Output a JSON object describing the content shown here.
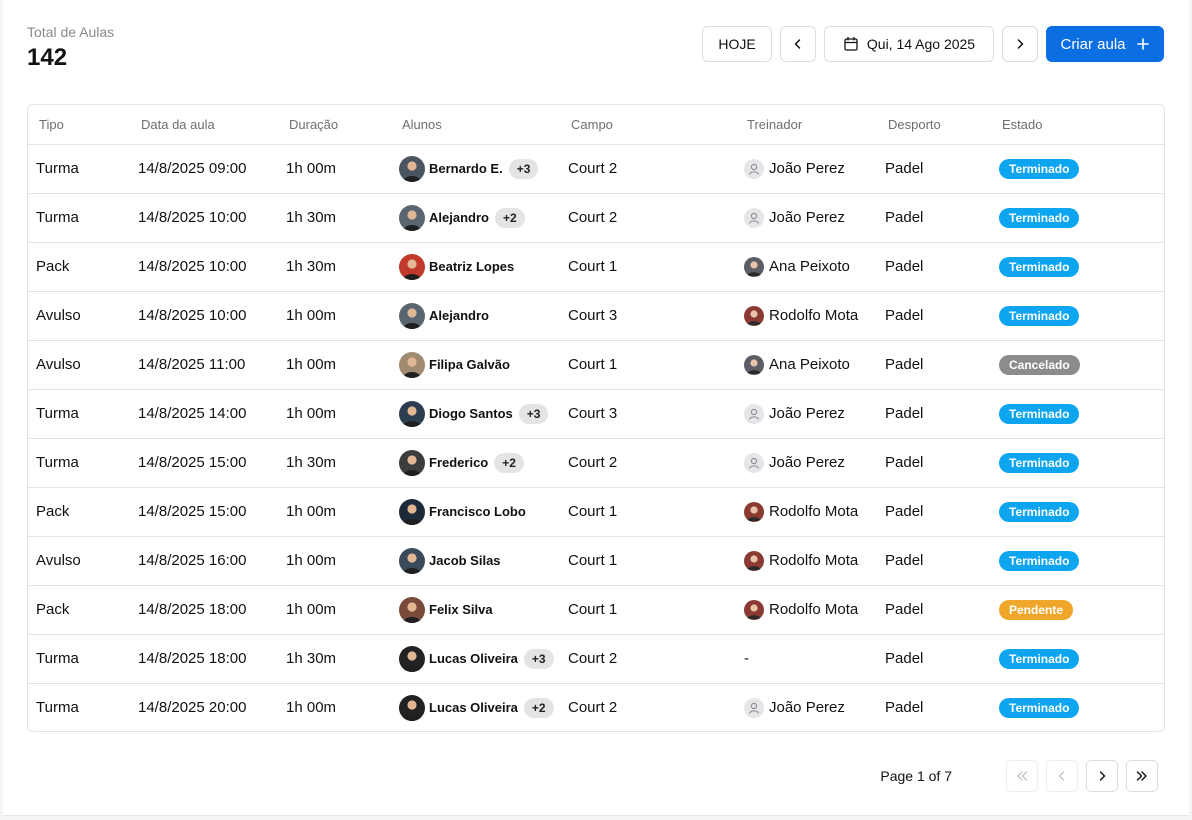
{
  "header": {
    "total_label": "Total de Aulas",
    "total_value": "142"
  },
  "toolbar": {
    "today_label": "HOJE",
    "date_label": "Qui, 14 Ago 2025",
    "create_label": "Criar aula",
    "accent_color": "#0b6ee3"
  },
  "table": {
    "columns": [
      "Tipo",
      "Data da aula",
      "Duração",
      "Alunos",
      "Campo",
      "Treinador",
      "Desporto",
      "Estado"
    ],
    "rows": [
      {
        "tipo": "Turma",
        "data": "14/8/2025 09:00",
        "duracao": "1h 00m",
        "aluno": "Bernardo E.",
        "extra": "+3",
        "campo": "Court 2",
        "treinador": "João Perez",
        "desporto": "Padel",
        "estado": "Terminado"
      },
      {
        "tipo": "Turma",
        "data": "14/8/2025 10:00",
        "duracao": "1h 30m",
        "aluno": "Alejandro",
        "extra": "+2",
        "campo": "Court 2",
        "treinador": "João Perez",
        "desporto": "Padel",
        "estado": "Terminado"
      },
      {
        "tipo": "Pack",
        "data": "14/8/2025 10:00",
        "duracao": "1h 30m",
        "aluno": "Beatriz Lopes",
        "extra": "",
        "campo": "Court 1",
        "treinador": "Ana Peixoto",
        "desporto": "Padel",
        "estado": "Terminado"
      },
      {
        "tipo": "Avulso",
        "data": "14/8/2025 10:00",
        "duracao": "1h 00m",
        "aluno": "Alejandro",
        "extra": "",
        "campo": "Court 3",
        "treinador": "Rodolfo Mota",
        "desporto": "Padel",
        "estado": "Terminado"
      },
      {
        "tipo": "Avulso",
        "data": "14/8/2025 11:00",
        "duracao": "1h 00m",
        "aluno": "Filipa Galvão",
        "extra": "",
        "campo": "Court 1",
        "treinador": "Ana Peixoto",
        "desporto": "Padel",
        "estado": "Cancelado"
      },
      {
        "tipo": "Turma",
        "data": "14/8/2025 14:00",
        "duracao": "1h 00m",
        "aluno": "Diogo Santos",
        "extra": "+3",
        "campo": "Court 3",
        "treinador": "João Perez",
        "desporto": "Padel",
        "estado": "Terminado"
      },
      {
        "tipo": "Turma",
        "data": "14/8/2025 15:00",
        "duracao": "1h 30m",
        "aluno": "Frederico",
        "extra": "+2",
        "campo": "Court 2",
        "treinador": "João Perez",
        "desporto": "Padel",
        "estado": "Terminado"
      },
      {
        "tipo": "Pack",
        "data": "14/8/2025 15:00",
        "duracao": "1h 00m",
        "aluno": "Francisco Lobo",
        "extra": "",
        "campo": "Court 1",
        "treinador": "Rodolfo Mota",
        "desporto": "Padel",
        "estado": "Terminado"
      },
      {
        "tipo": "Avulso",
        "data": "14/8/2025 16:00",
        "duracao": "1h 00m",
        "aluno": "Jacob Silas",
        "extra": "",
        "campo": "Court 1",
        "treinador": "Rodolfo Mota",
        "desporto": "Padel",
        "estado": "Terminado"
      },
      {
        "tipo": "Pack",
        "data": "14/8/2025 18:00",
        "duracao": "1h 00m",
        "aluno": "Felix Silva",
        "extra": "",
        "campo": "Court 1",
        "treinador": "Rodolfo Mota",
        "desporto": "Padel",
        "estado": "Pendente"
      },
      {
        "tipo": "Turma",
        "data": "14/8/2025 18:00",
        "duracao": "1h 30m",
        "aluno": "Lucas Oliveira",
        "extra": "+3",
        "campo": "Court 2",
        "treinador": "-",
        "desporto": "Padel",
        "estado": "Terminado"
      },
      {
        "tipo": "Turma",
        "data": "14/8/2025 20:00",
        "duracao": "1h 00m",
        "aluno": "Lucas Oliveira",
        "extra": "+2",
        "campo": "Court 2",
        "treinador": "João Perez",
        "desporto": "Padel",
        "estado": "Terminado"
      }
    ]
  },
  "status_colors": {
    "Terminado": "#0ea5f0",
    "Cancelado": "#8c8c8c",
    "Pendente": "#f0a62a"
  },
  "avatar_colors": {
    "Bernardo E.": "#4a5560",
    "Alejandro": "#5a6572",
    "Beatriz Lopes": "#c0392b",
    "Filipa Galvão": "#a08a70",
    "Diogo Santos": "#2c3e50",
    "Frederico": "#3d3d3d",
    "Francisco Lobo": "#1c2a3a",
    "Jacob Silas": "#3b4a5a",
    "Felix Silva": "#7a4a3a",
    "Lucas Oliveira": "#222222",
    "Ana Peixoto": "#5d5d66",
    "Rodolfo Mota": "#8a3a32"
  },
  "pagination": {
    "label": "Page 1 of 7"
  }
}
